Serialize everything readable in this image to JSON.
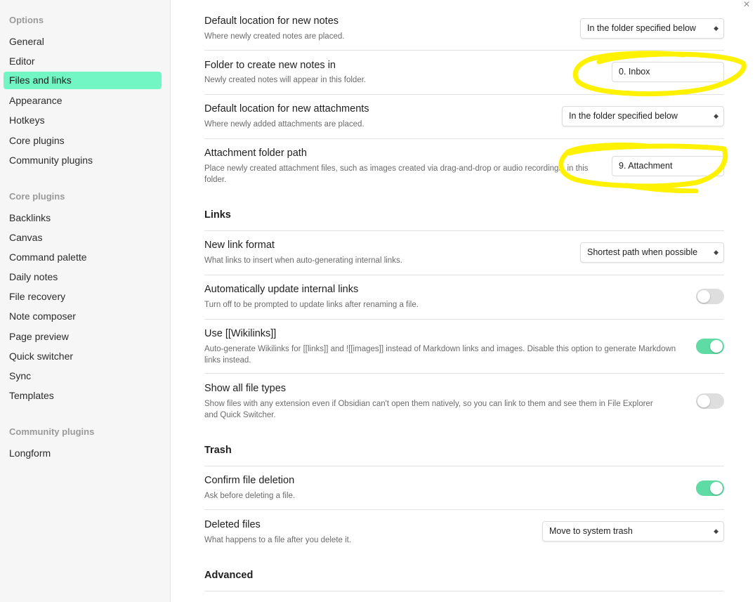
{
  "sidebar": {
    "options_title": "Options",
    "options_items": [
      "General",
      "Editor",
      "Files and links",
      "Appearance",
      "Hotkeys",
      "Core plugins",
      "Community plugins"
    ],
    "core_title": "Core plugins",
    "core_items": [
      "Backlinks",
      "Canvas",
      "Command palette",
      "Daily notes",
      "File recovery",
      "Note composer",
      "Page preview",
      "Quick switcher",
      "Sync",
      "Templates"
    ],
    "community_title": "Community plugins",
    "community_items": [
      "Longform"
    ]
  },
  "close_icon": "×",
  "settings": {
    "new_note_location": {
      "title": "Default location for new notes",
      "desc": "Where newly created notes are placed.",
      "value": "In the folder specified below"
    },
    "new_note_folder": {
      "title": "Folder to create new notes in",
      "desc": "Newly created notes will appear in this folder.",
      "value": "0. Inbox"
    },
    "attachment_location": {
      "title": "Default location for new attachments",
      "desc": "Where newly added attachments are placed.",
      "value": "In the folder specified below"
    },
    "attachment_folder": {
      "title": "Attachment folder path",
      "desc": "Place newly created attachment files, such as images created via drag-and-drop or audio recordings, in this folder.",
      "value": "9. Attachment"
    }
  },
  "links": {
    "heading": "Links",
    "new_link_format": {
      "title": "New link format",
      "desc": "What links to insert when auto-generating internal links.",
      "value": "Shortest path when possible"
    },
    "auto_update": {
      "title": "Automatically update internal links",
      "desc": "Turn off to be prompted to update links after renaming a file.",
      "enabled": false
    },
    "wikilinks": {
      "title": "Use [[Wikilinks]]",
      "desc": "Auto-generate Wikilinks for [[links]] and ![[images]] instead of Markdown links and images. Disable this option to generate Markdown links instead.",
      "enabled": true
    },
    "show_all_types": {
      "title": "Show all file types",
      "desc": "Show files with any extension even if Obsidian can't open them natively, so you can link to them and see them in File Explorer and Quick Switcher.",
      "enabled": false
    }
  },
  "trash": {
    "heading": "Trash",
    "confirm_delete": {
      "title": "Confirm file deletion",
      "desc": "Ask before deleting a file.",
      "enabled": true
    },
    "deleted_files": {
      "title": "Deleted files",
      "desc": "What happens to a file after you delete it.",
      "value": "Move to system trash"
    }
  },
  "advanced": {
    "heading": "Advanced"
  },
  "colors": {
    "accent": "#72f6c4",
    "toggle_on": "#5fdca6",
    "annotation": "#fff200"
  }
}
